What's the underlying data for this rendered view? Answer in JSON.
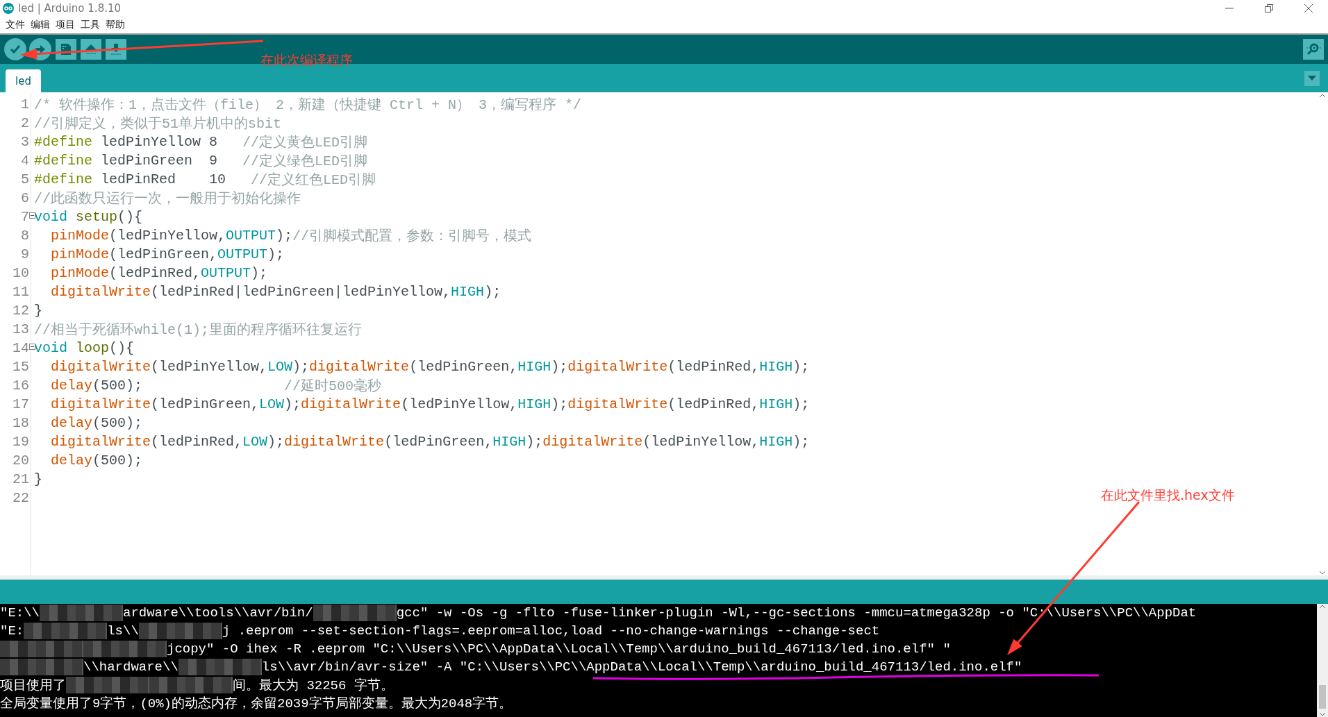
{
  "window": {
    "title": "led | Arduino 1.8.10"
  },
  "menu": [
    "文件",
    "编辑",
    "项目",
    "工具",
    "帮助"
  ],
  "tabs": [
    {
      "label": "led",
      "selected": true
    }
  ],
  "editor": {
    "lines": [
      {
        "number": "1",
        "fold": false,
        "tokens": [
          {
            "kind": "comment",
            "text": "/* 软件操作：1，点击文件（file） 2，新建（快捷键 Ctrl + N） 3，编写程序 */"
          }
        ]
      },
      {
        "number": "2",
        "fold": false,
        "tokens": [
          {
            "kind": "comment",
            "text": "//引脚定义，类似于51单片机中的sbit"
          }
        ]
      },
      {
        "number": "3",
        "fold": false,
        "tokens": [
          {
            "kind": "directive",
            "text": "#define"
          },
          {
            "kind": "plain",
            "text": " ledPinYellow 8   "
          },
          {
            "kind": "comment",
            "text": "//定义黄色LED引脚"
          }
        ]
      },
      {
        "number": "4",
        "fold": false,
        "tokens": [
          {
            "kind": "directive",
            "text": "#define"
          },
          {
            "kind": "plain",
            "text": " ledPinGreen  9   "
          },
          {
            "kind": "comment",
            "text": "//定义绿色LED引脚"
          }
        ]
      },
      {
        "number": "5",
        "fold": false,
        "tokens": [
          {
            "kind": "directive",
            "text": "#define"
          },
          {
            "kind": "plain",
            "text": " ledPinRed    10   "
          },
          {
            "kind": "comment",
            "text": "//定义红色LED引脚"
          }
        ]
      },
      {
        "number": "6",
        "fold": false,
        "tokens": [
          {
            "kind": "comment",
            "text": "//此函数只运行一次，一般用于初始化操作"
          }
        ]
      },
      {
        "number": "7",
        "fold": true,
        "tokens": [
          {
            "kind": "type",
            "text": "void "
          },
          {
            "kind": "name",
            "text": "setup"
          },
          {
            "kind": "plain",
            "text": "(){"
          }
        ]
      },
      {
        "number": "8",
        "fold": false,
        "tokens": [
          {
            "kind": "func",
            "text": "  pinMode"
          },
          {
            "kind": "plain",
            "text": "(ledPinYellow,"
          },
          {
            "kind": "constant",
            "text": "OUTPUT"
          },
          {
            "kind": "plain",
            "text": ");"
          },
          {
            "kind": "comment",
            "text": "//引脚模式配置，参数：引脚号，模式"
          }
        ]
      },
      {
        "number": "9",
        "fold": false,
        "tokens": [
          {
            "kind": "func",
            "text": "  pinMode"
          },
          {
            "kind": "plain",
            "text": "(ledPinGreen,"
          },
          {
            "kind": "constant",
            "text": "OUTPUT"
          },
          {
            "kind": "plain",
            "text": ");"
          }
        ]
      },
      {
        "number": "10",
        "fold": false,
        "tokens": [
          {
            "kind": "func",
            "text": "  pinMode"
          },
          {
            "kind": "plain",
            "text": "(ledPinRed,"
          },
          {
            "kind": "constant",
            "text": "OUTPUT"
          },
          {
            "kind": "plain",
            "text": ");"
          }
        ]
      },
      {
        "number": "11",
        "fold": false,
        "tokens": [
          {
            "kind": "func",
            "text": "  digitalWrite"
          },
          {
            "kind": "plain",
            "text": "(ledPinRed|ledPinGreen|ledPinYellow,"
          },
          {
            "kind": "constant",
            "text": "HIGH"
          },
          {
            "kind": "plain",
            "text": ");"
          }
        ]
      },
      {
        "number": "12",
        "fold": false,
        "tokens": [
          {
            "kind": "plain",
            "text": "}"
          }
        ]
      },
      {
        "number": "13",
        "fold": false,
        "tokens": [
          {
            "kind": "comment",
            "text": "//相当于死循环while(1);里面的程序循环往复运行"
          }
        ]
      },
      {
        "number": "14",
        "fold": true,
        "tokens": [
          {
            "kind": "type",
            "text": "void "
          },
          {
            "kind": "name",
            "text": "loop"
          },
          {
            "kind": "plain",
            "text": "(){"
          }
        ]
      },
      {
        "number": "15",
        "fold": false,
        "tokens": [
          {
            "kind": "func",
            "text": "  digitalWrite"
          },
          {
            "kind": "plain",
            "text": "(ledPinYellow,"
          },
          {
            "kind": "constant",
            "text": "LOW"
          },
          {
            "kind": "plain",
            "text": ");"
          },
          {
            "kind": "func",
            "text": "digitalWrite"
          },
          {
            "kind": "plain",
            "text": "(ledPinGreen,"
          },
          {
            "kind": "constant",
            "text": "HIGH"
          },
          {
            "kind": "plain",
            "text": ");"
          },
          {
            "kind": "func",
            "text": "digitalWrite"
          },
          {
            "kind": "plain",
            "text": "(ledPinRed,"
          },
          {
            "kind": "constant",
            "text": "HIGH"
          },
          {
            "kind": "plain",
            "text": ");"
          }
        ]
      },
      {
        "number": "16",
        "fold": false,
        "tokens": [
          {
            "kind": "func",
            "text": "  delay"
          },
          {
            "kind": "plain",
            "text": "(500);                 "
          },
          {
            "kind": "comment",
            "text": "//延时500毫秒"
          }
        ]
      },
      {
        "number": "17",
        "fold": false,
        "tokens": [
          {
            "kind": "func",
            "text": "  digitalWrite"
          },
          {
            "kind": "plain",
            "text": "(ledPinGreen,"
          },
          {
            "kind": "constant",
            "text": "LOW"
          },
          {
            "kind": "plain",
            "text": ");"
          },
          {
            "kind": "func",
            "text": "digitalWrite"
          },
          {
            "kind": "plain",
            "text": "(ledPinYellow,"
          },
          {
            "kind": "constant",
            "text": "HIGH"
          },
          {
            "kind": "plain",
            "text": ");"
          },
          {
            "kind": "func",
            "text": "digitalWrite"
          },
          {
            "kind": "plain",
            "text": "(ledPinRed,"
          },
          {
            "kind": "constant",
            "text": "HIGH"
          },
          {
            "kind": "plain",
            "text": ");"
          }
        ]
      },
      {
        "number": "18",
        "fold": false,
        "tokens": [
          {
            "kind": "func",
            "text": "  delay"
          },
          {
            "kind": "plain",
            "text": "(500);"
          }
        ]
      },
      {
        "number": "19",
        "fold": false,
        "tokens": [
          {
            "kind": "func",
            "text": "  digitalWrite"
          },
          {
            "kind": "plain",
            "text": "(ledPinRed,"
          },
          {
            "kind": "constant",
            "text": "LOW"
          },
          {
            "kind": "plain",
            "text": ");"
          },
          {
            "kind": "func",
            "text": "digitalWrite"
          },
          {
            "kind": "plain",
            "text": "(ledPinGreen,"
          },
          {
            "kind": "constant",
            "text": "HIGH"
          },
          {
            "kind": "plain",
            "text": ");"
          },
          {
            "kind": "func",
            "text": "digitalWrite"
          },
          {
            "kind": "plain",
            "text": "(ledPinYellow,"
          },
          {
            "kind": "constant",
            "text": "HIGH"
          },
          {
            "kind": "plain",
            "text": ");"
          }
        ]
      },
      {
        "number": "20",
        "fold": false,
        "tokens": [
          {
            "kind": "func",
            "text": "  delay"
          },
          {
            "kind": "plain",
            "text": "(500);"
          }
        ]
      },
      {
        "number": "21",
        "fold": false,
        "tokens": [
          {
            "kind": "plain",
            "text": "}"
          }
        ]
      },
      {
        "number": "22",
        "fold": false
      }
    ]
  },
  "console": {
    "lines": [
      {
        "parts": [
          {
            "kind": "text",
            "text": "\"E:\\\\"
          },
          {
            "kind": "mosaic"
          },
          {
            "kind": "text",
            "text": "ardware\\\\tools\\\\avr/bin/"
          },
          {
            "kind": "mosaic"
          },
          {
            "kind": "text",
            "text": "gcc\" -w -Os -g -flto -fuse-linker-plugin -Wl,--gc-sections -mmcu=atmega328p -o \"C:\\\\Users\\\\PC\\\\AppDat"
          }
        ]
      },
      {
        "parts": [
          {
            "kind": "text",
            "text": "\"E:"
          },
          {
            "kind": "mosaic"
          },
          {
            "kind": "text",
            "text": "ls\\\\"
          },
          {
            "kind": "mosaic"
          },
          {
            "kind": "text",
            "text": "j .eeprom --set-section-flags=.eeprom=alloc,load --no-change-warnings --change-sect"
          }
        ]
      },
      {
        "parts": [
          {
            "kind": "mosaic"
          },
          {
            "kind": "mosaic"
          },
          {
            "kind": "text",
            "text": "jcopy\" -O ihex -R .eeprom \"C:\\\\Users\\\\PC\\\\AppData\\\\Local\\\\Temp\\\\arduino_build_467113/led.ino.elf\" \""
          }
        ]
      },
      {
        "parts": [
          {
            "kind": "mosaic"
          },
          {
            "kind": "text",
            "text": "\\\\hardware\\\\"
          },
          {
            "kind": "mosaic"
          },
          {
            "kind": "text",
            "text": "ls\\\\avr/bin/avr-size\" -A \"C:\\\\Users\\\\PC\\\\AppData\\\\Local\\\\Temp\\\\arduino_build_467113/led.ino.elf\""
          }
        ]
      },
      {
        "parts": [
          {
            "kind": "text",
            "text": "项目使用了"
          },
          {
            "kind": "mosaic"
          },
          {
            "kind": "mosaic"
          },
          {
            "kind": "text",
            "text": "间。最大为 32256 字节。"
          }
        ]
      },
      {
        "parts": [
          {
            "kind": "text",
            "text": "全局变量使用了9字节，(0%)的动态内存，余留2039字节局部变量。最大为2048字节。"
          }
        ]
      }
    ]
  },
  "annotations": [
    {
      "kind": "callout",
      "text": "在此次编译程序"
    },
    {
      "kind": "callout",
      "text": "在此文件里找.hex文件"
    },
    {
      "kind": "underline"
    }
  ]
}
